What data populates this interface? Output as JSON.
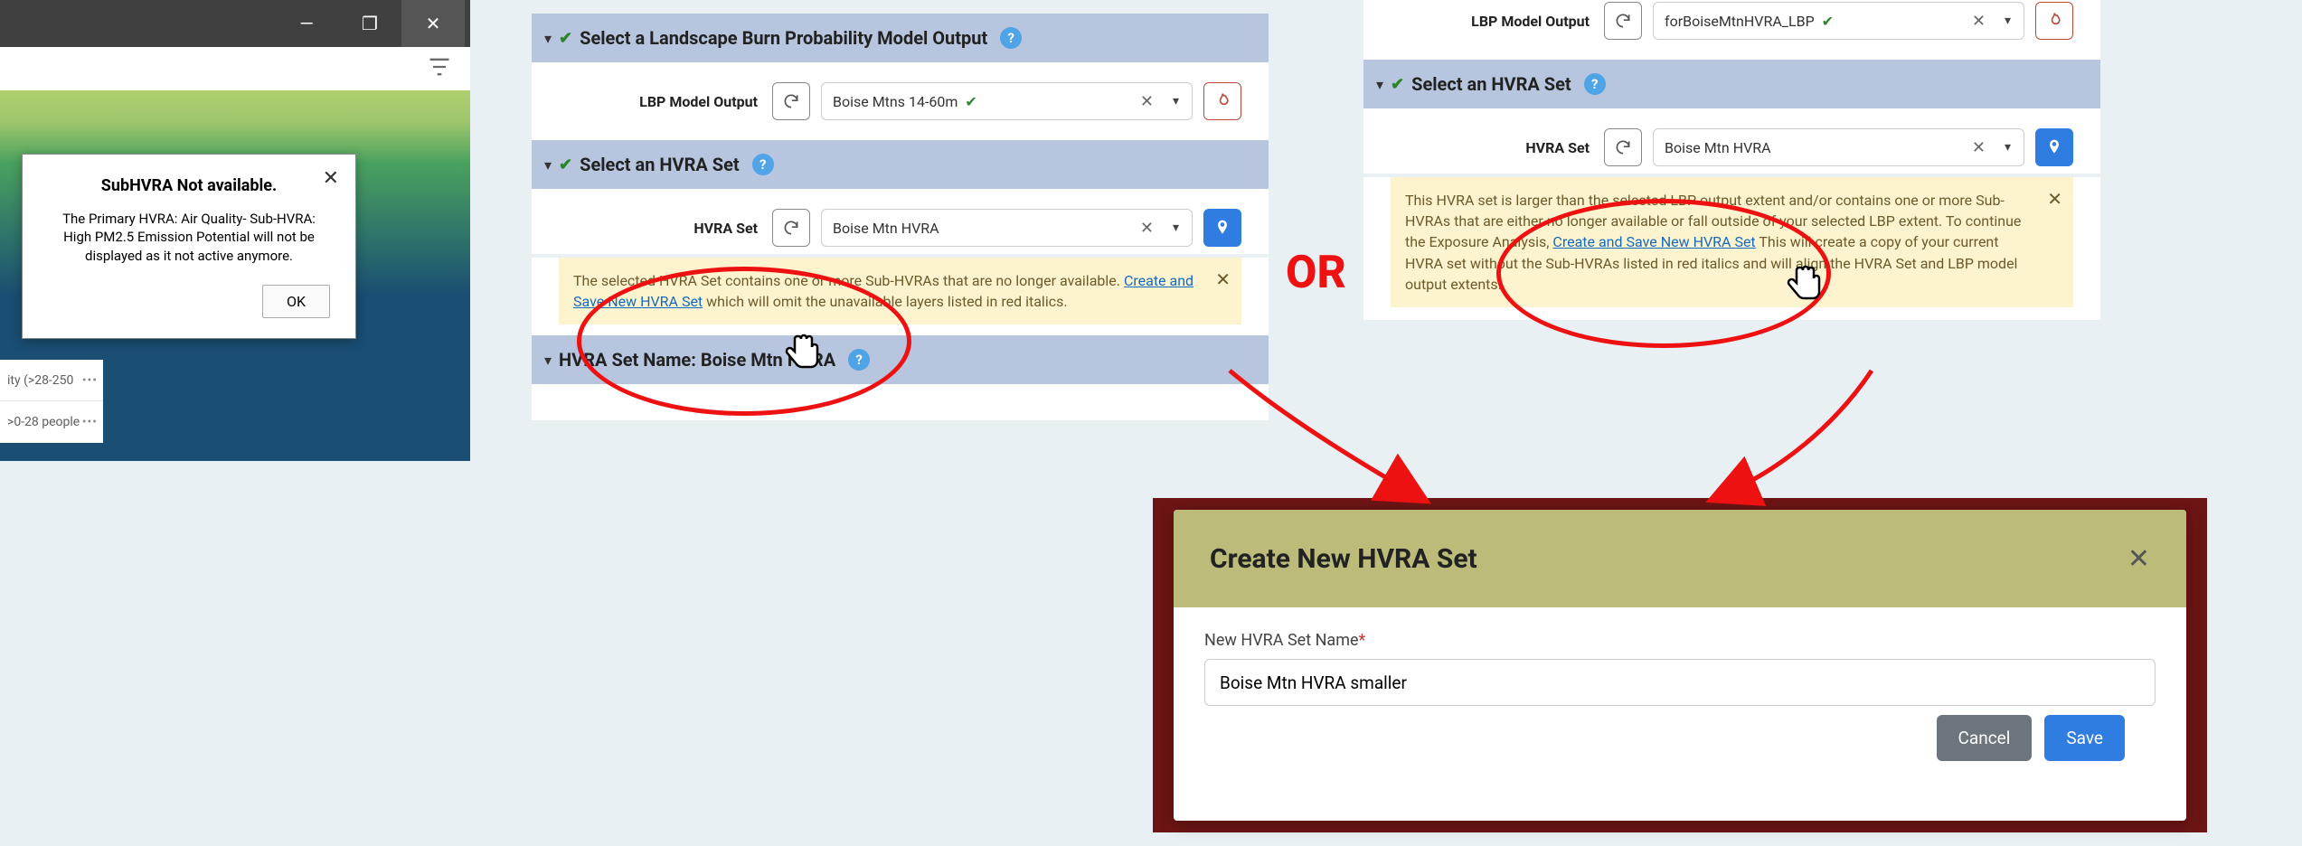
{
  "popup": {
    "title": "SubHVRA Not available.",
    "body": "The Primary HVRA: Air Quality- Sub-HVRA: High PM2.5 Emission Potential will not be displayed as it not active anymore.",
    "ok": "OK"
  },
  "legend": {
    "row1": "ity (>28-250",
    "row2": ">0-28 people"
  },
  "panelA": {
    "sec1_title": "Select a Landscape Burn Probability Model Output",
    "lbp_label": "LBP Model Output",
    "lbp_value": "Boise Mtns 14-60m",
    "sec2_title": "Select an HVRA Set",
    "hvra_label": "HVRA Set",
    "hvra_value": "Boise Mtn HVRA",
    "warn_a": "The selected HVRA Set contains one or more Sub-HVRAs that are no longer available. ",
    "warn_link": "Create and Save New HVRA Set",
    "warn_b": " which will omit the unavailable layers listed in red italics.",
    "sec3_title": "HVRA Set Name: Boise Mtn HVRA"
  },
  "panelB": {
    "lbp_label": "LBP Model Output",
    "lbp_value": "forBoiseMtnHVRA_LBP",
    "sec2_title": "Select an HVRA Set",
    "hvra_label": "HVRA Set",
    "hvra_value": "Boise Mtn HVRA",
    "warn_a": "This HVRA set is larger than the selected LBP output extent and/or contains one or more Sub-HVRAs that are either no longer available or fall outside of your selected LBP extent. To continue the Exposure Analysis, ",
    "warn_link": "Create and Save New HVRA Set",
    "warn_b": " This will create a copy of your current HVRA set without the Sub-HVRAs listed in red italics and will align the HVRA Set and LBP model output extents."
  },
  "or_text": "OR",
  "modal": {
    "title": "Create New HVRA Set",
    "label": "New HVRA Set Name",
    "value": "Boise Mtn HVRA smaller",
    "cancel": "Cancel",
    "save": "Save"
  }
}
